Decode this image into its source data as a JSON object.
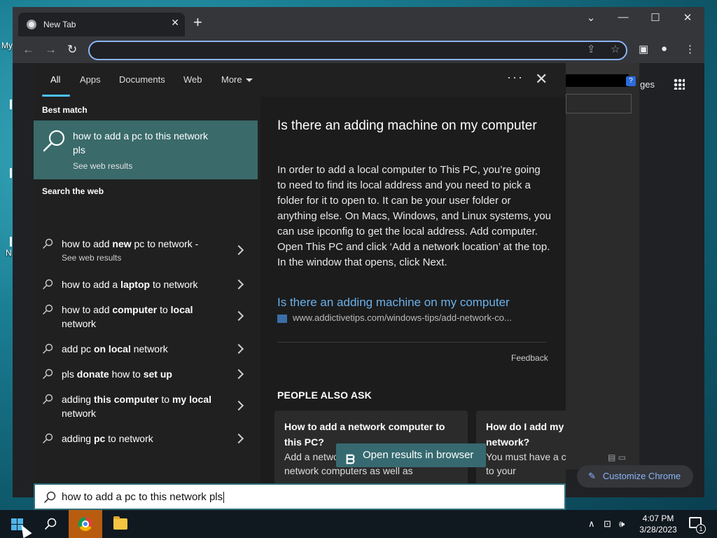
{
  "desktop": {
    "label_top": "My",
    "label_mid": "N"
  },
  "chrome": {
    "tab_title": "New Tab",
    "tab_close": "✕",
    "new_tab": "+",
    "images_link": "ges",
    "help": "?",
    "customize_label": "Customize Chrome"
  },
  "search_panel": {
    "tabs": [
      "All",
      "Apps",
      "Documents",
      "Web",
      "More"
    ],
    "more_dots": "···",
    "close": "✕",
    "best_match_heading": "Best match",
    "best_match": {
      "title": "how to add a pc to this network pls",
      "subtitle": "See web results"
    },
    "search_web_heading": "Search the web",
    "web_items": [
      {
        "html": "how to add <b>new</b> pc to network -",
        "sub": "See web results"
      },
      {
        "html": "how to add a <b>laptop</b> to network",
        "sub": ""
      },
      {
        "html": "how to add <b>computer</b> to <b>local</b> network",
        "sub": ""
      },
      {
        "html": "add pc <b>on local</b> network",
        "sub": ""
      },
      {
        "html": "pls <b>donate</b> how to <b>set up</b>",
        "sub": ""
      },
      {
        "html": "adding <b>this computer</b> to <b>my local</b> network",
        "sub": ""
      },
      {
        "html": "adding <b>pc</b> to network",
        "sub": ""
      }
    ],
    "answer": {
      "title": "Is there an adding machine on my computer",
      "body": "In order to add a local computer to This PC, you’re going to need to find its local address and you need to pick a folder for it to open to. It can be your user folder or anything else. On Macs, Windows, and Linux systems, you can use ipconfig to get the local address. Add computer. Open This PC and click ‘Add a network location’ at the top. In the window that opens, click Next.",
      "link": "Is there an adding machine on my computer",
      "url": "www.addictivetips.com/windows-tips/add-network-co...",
      "feedback": "Feedback"
    },
    "people_also_ask_heading": "PEOPLE ALSO ASK",
    "paa_cards": [
      {
        "q": "How to add a network computer to this PC?",
        "a": "Add a network location. This works for network computers as well as"
      },
      {
        "q": "How do I add my PC to my Linksys network?",
        "a": "You must have a computer connected to your"
      }
    ],
    "open_in_browser": "Open results in browser"
  },
  "searchbox": {
    "value": "how to add a pc to this network pls"
  },
  "taskbar": {
    "time": "4:07 PM",
    "date": "3/28/2023",
    "notification_count": "1",
    "tray_up": "∧"
  }
}
